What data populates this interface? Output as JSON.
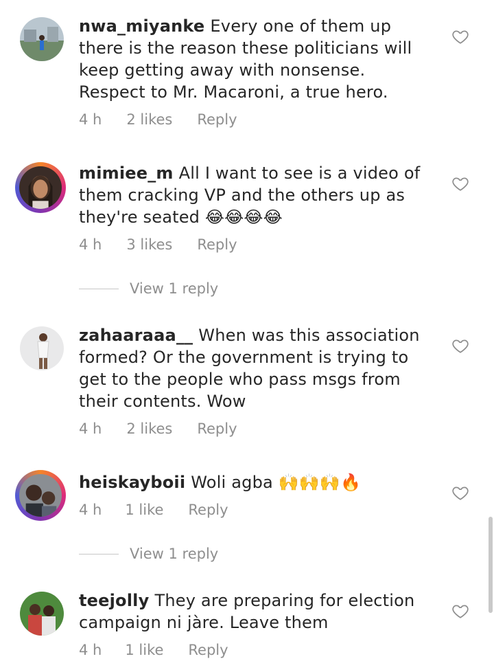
{
  "comments": [
    {
      "username": "nwa_miyanke",
      "text": "Every one of them up there is the reason these politicians will keep getting away with nonsense. Respect to Mr. Macaroni, a true hero.",
      "time": "4 h",
      "likes": "2 likes",
      "reply_label": "Reply",
      "avatar": "avatar-nwa_miyanke",
      "has_story_ring": false
    },
    {
      "username": "mimiee_m",
      "text": "All I want to see is a video of them cracking VP and the others up as they're seated 😂😂😂😂",
      "time": "4 h",
      "likes": "3 likes",
      "reply_label": "Reply",
      "view_replies": "View 1 reply",
      "avatar": "avatar-mimiee_m",
      "has_story_ring": true
    },
    {
      "username": "zahaaraaa__",
      "text": "When was this association formed? Or the government is trying to get to the people who pass msgs from their contents. Wow",
      "time": "4 h",
      "likes": "2 likes",
      "reply_label": "Reply",
      "avatar": "avatar-zahaaraaa",
      "has_story_ring": false
    },
    {
      "username": "heiskayboii",
      "text": "Woli agba 🙌🙌🙌🔥",
      "time": "4 h",
      "likes": "1 like",
      "reply_label": "Reply",
      "view_replies": "View 1 reply",
      "avatar": "avatar-heiskayboii",
      "has_story_ring": true
    },
    {
      "username": "teejolly",
      "text": "They are preparing for election campaign ni jàre. Leave them",
      "time": "4 h",
      "likes": "1 like",
      "reply_label": "Reply",
      "avatar": "avatar-teejolly",
      "has_story_ring": false
    }
  ],
  "icons": {
    "like": "heart-outline-icon"
  },
  "colors": {
    "text": "#262626",
    "meta": "#8e8e8e",
    "story_ring_start": "#f58529",
    "story_ring_end": "#515bd4"
  }
}
